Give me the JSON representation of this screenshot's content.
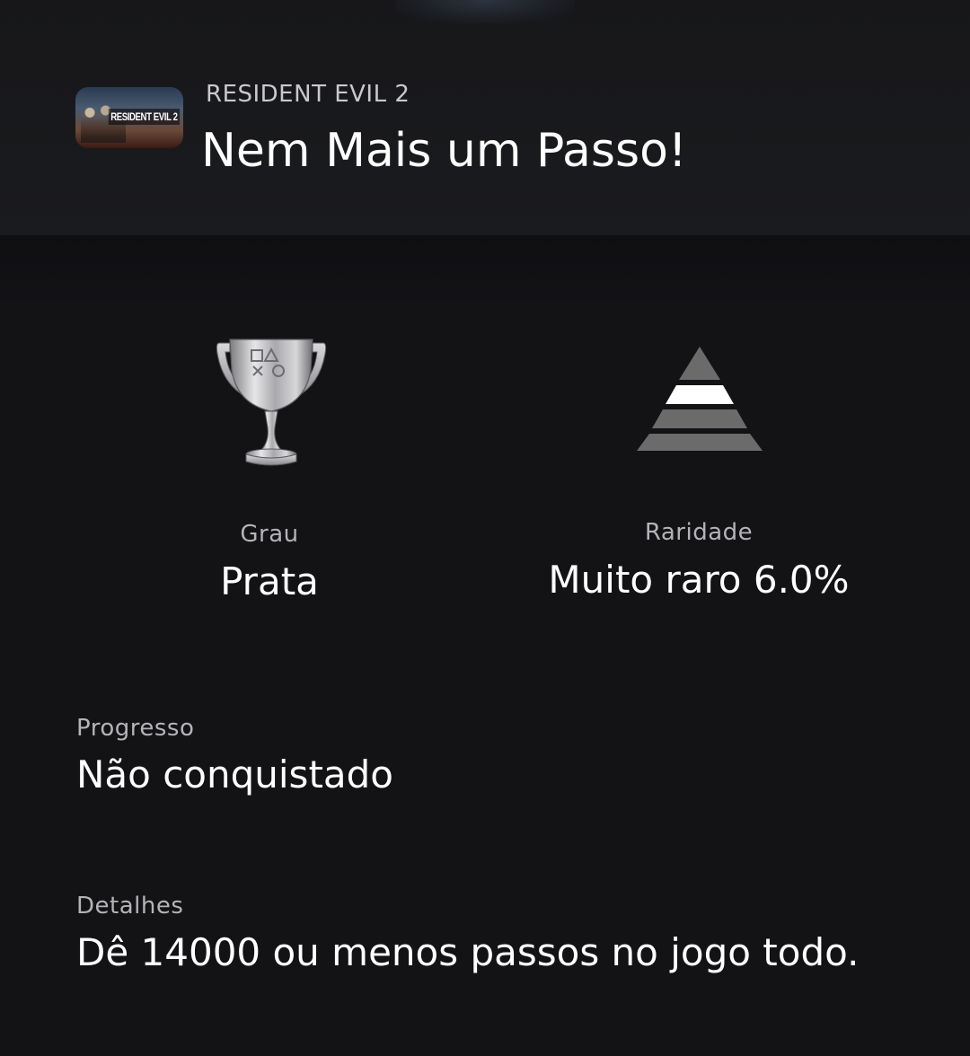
{
  "header": {
    "game_name": "RESIDENT EVIL 2",
    "trophy_title": "Nem Mais um Passo!",
    "thumbnail_logo": "RESIDENT EVIL 2"
  },
  "stats": {
    "grade": {
      "label": "Grau",
      "value": "Prata",
      "icon": "silver-trophy-icon"
    },
    "rarity": {
      "label": "Raridade",
      "value": "Muito raro 6.0%",
      "icon": "rarity-pyramid-icon",
      "highlighted_tier": 2
    }
  },
  "progress": {
    "label": "Progresso",
    "value": "Não conquistado"
  },
  "details": {
    "label": "Detalhes",
    "value": "Dê 14000 ou menos passos no jogo todo."
  },
  "colors": {
    "background": "#131316",
    "header_background": "#1a1b1e",
    "label": "#b4b4b8",
    "text": "#ffffff",
    "pyramid_gray": "#6b6b6b",
    "pyramid_highlight": "#ffffff"
  }
}
